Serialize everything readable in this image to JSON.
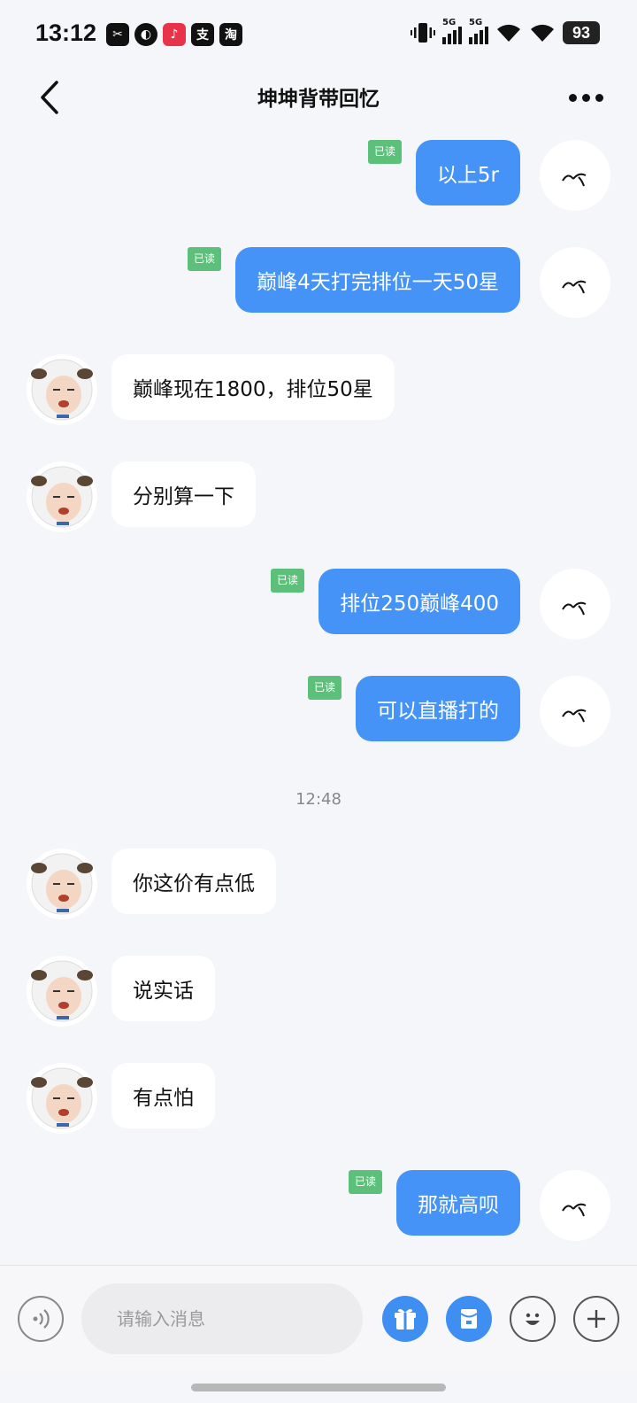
{
  "status_bar": {
    "time": "13:12",
    "notification_icons": [
      "capcut-icon",
      "flame-app-icon",
      "red-app-icon",
      "zhi-app-icon",
      "taobao-icon"
    ],
    "notification_glyphs": [
      "✂",
      "◐",
      "♪",
      "支",
      "淘"
    ],
    "network_label_1": "5G",
    "network_label_2": "5G",
    "battery": "93"
  },
  "header": {
    "title": "坤坤背带回忆"
  },
  "messages": [
    {
      "from": "me",
      "text": "以上5r",
      "read": "已读"
    },
    {
      "from": "me",
      "text": "巅峰4天打完排位一天50星",
      "read": "已读"
    },
    {
      "from": "them",
      "text": "巅峰现在1800，排位50星"
    },
    {
      "from": "them",
      "text": "分别算一下"
    },
    {
      "from": "me",
      "text": "排位250巅峰400",
      "read": "已读"
    },
    {
      "from": "me",
      "text": "可以直播打的",
      "read": "已读"
    },
    {
      "from": "time",
      "text": "12:48"
    },
    {
      "from": "them",
      "text": "你这价有点低"
    },
    {
      "from": "them",
      "text": "说实话"
    },
    {
      "from": "them",
      "text": "有点怕"
    },
    {
      "from": "me",
      "text": "那就高呗",
      "read": "已读"
    }
  ],
  "input_bar": {
    "placeholder": "请输入消息"
  },
  "colors": {
    "my_bubble": "#4593f7",
    "their_bubble": "#ffffff",
    "read_badge": "#5cc07b",
    "background": "#f4f6f9"
  }
}
